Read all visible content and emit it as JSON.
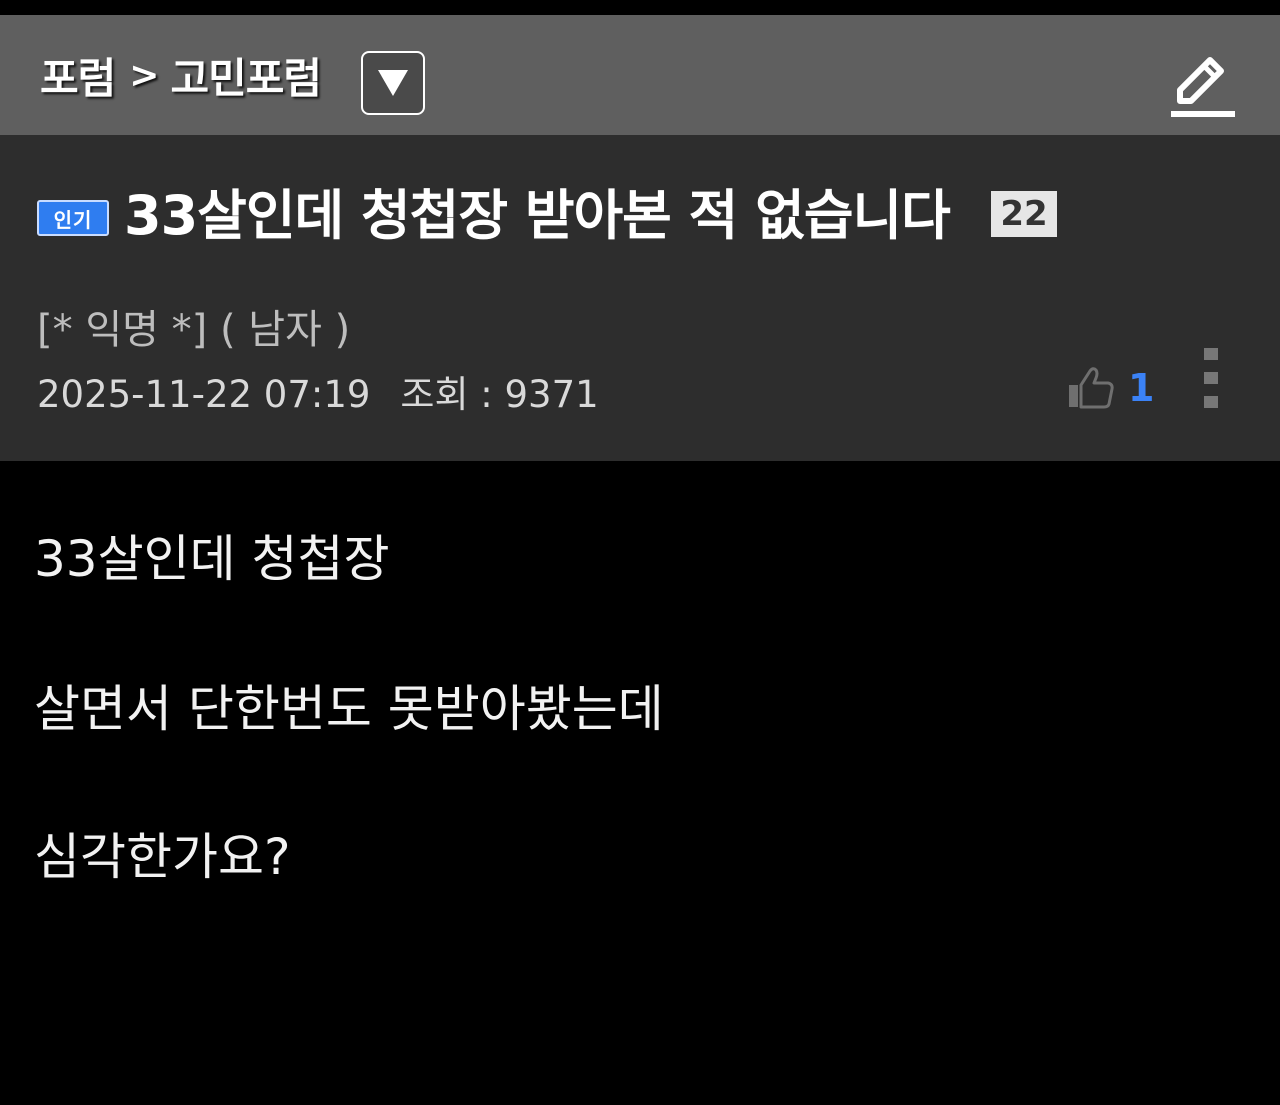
{
  "header": {
    "breadcrumb_root": "포럼",
    "breadcrumb_sep": ">",
    "breadcrumb_current": "고민포럼",
    "dropdown_icon": "triangle-down-icon",
    "edit_icon": "pencil-icon"
  },
  "post": {
    "badge": "인기",
    "title": "33살인데 청첩장 받아본 적 없습니다",
    "comment_count": "22",
    "author": "[* 익명 *] ( 남자 )",
    "datetime": "2025-11-22 07:19",
    "views": "조회 : 9371",
    "likes": "1"
  },
  "body": {
    "lines": [
      "33살인데 청첩장",
      "살면서 단한번도 못받아봤는데",
      "심각한가요?"
    ]
  },
  "colors": {
    "header_bg": "#5f5f5f",
    "post_head_bg": "#2d2d2d",
    "badge_bg": "#2f7df0",
    "like_accent": "#3b82f6"
  }
}
